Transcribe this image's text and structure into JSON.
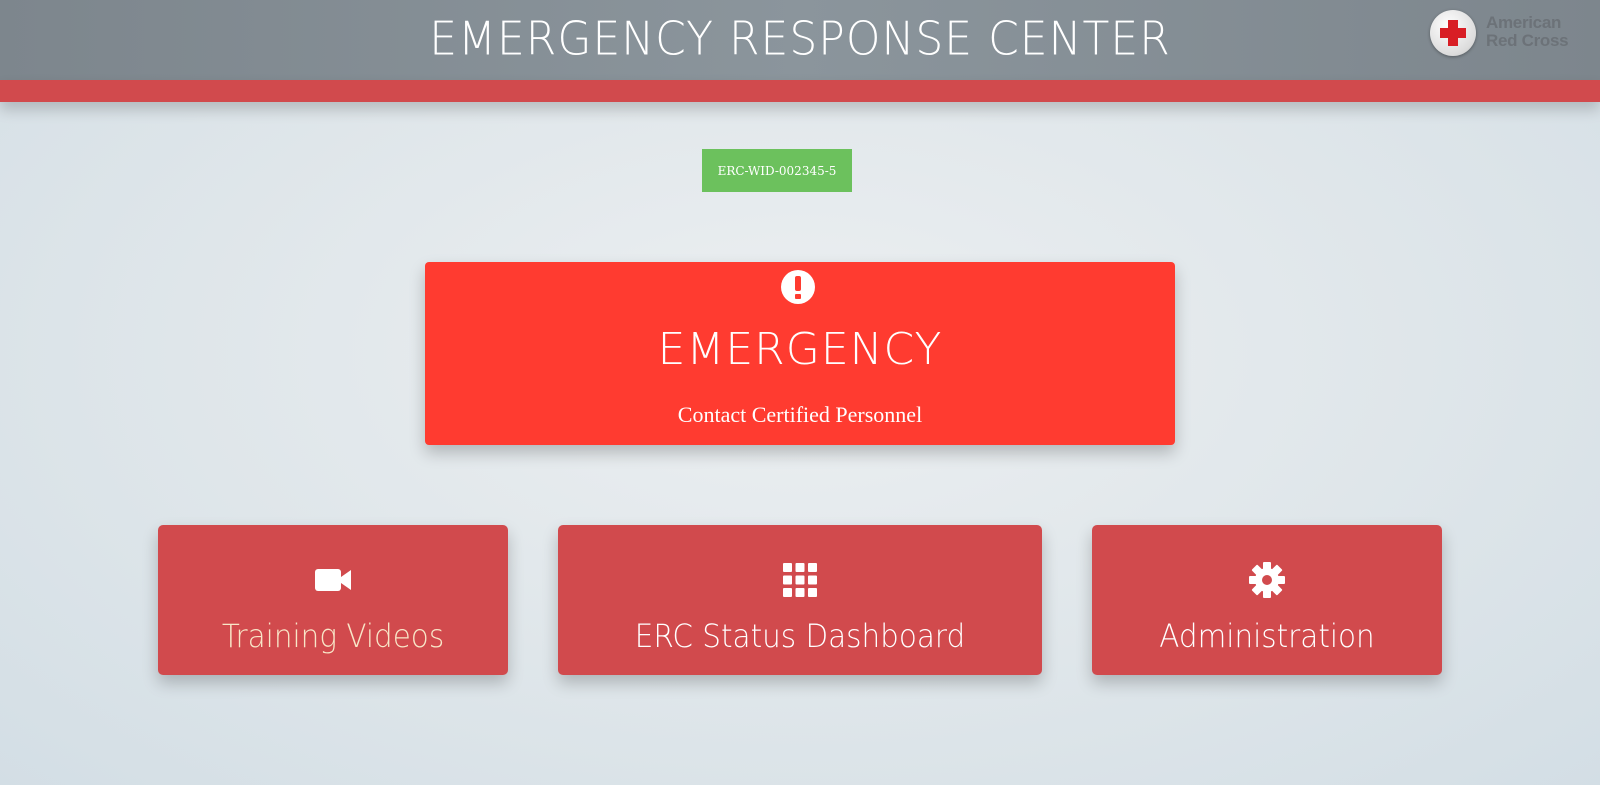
{
  "header": {
    "title": "EMERGENCY RESPONSE CENTER",
    "logo_line1": "American",
    "logo_line2": "Red Cross"
  },
  "badge": {
    "label": "ERC-WID-002345-5"
  },
  "emergency": {
    "icon": "exclamation-circle-icon",
    "title": "EMERGENCY",
    "subtitle": "Contact Certified Personnel"
  },
  "tiles": [
    {
      "icon": "video-camera-icon",
      "label": "Training Videos"
    },
    {
      "icon": "grid-icon",
      "label": "ERC Status Dashboard"
    },
    {
      "icon": "gear-icon",
      "label": "Administration"
    }
  ],
  "colors": {
    "header_bg": "#848d94",
    "accent_red": "#d14a4d",
    "emergency_red": "#ff3b30",
    "badge_green": "#6cc15d"
  }
}
